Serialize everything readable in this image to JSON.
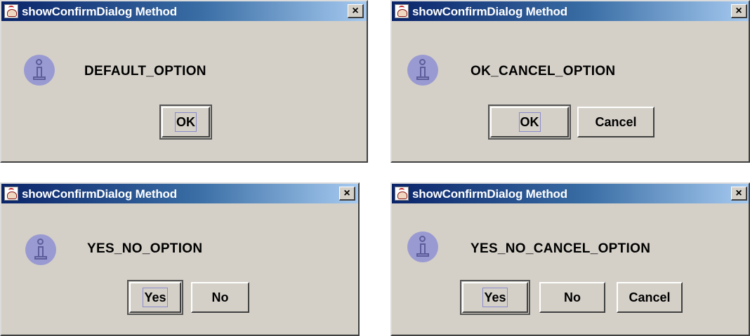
{
  "dialogs": [
    {
      "title": "showConfirmDialog Method",
      "close_label": "×",
      "icon": "information-icon",
      "message": "DEFAULT_OPTION",
      "buttons": [
        {
          "label": "OK",
          "default": true
        }
      ]
    },
    {
      "title": "showConfirmDialog Method",
      "close_label": "×",
      "icon": "information-icon",
      "message": "OK_CANCEL_OPTION",
      "buttons": [
        {
          "label": "OK",
          "default": true
        },
        {
          "label": "Cancel",
          "default": false
        }
      ]
    },
    {
      "title": "showConfirmDialog Method",
      "close_label": "×",
      "icon": "information-icon",
      "message": "YES_NO_OPTION",
      "buttons": [
        {
          "label": "Yes",
          "default": true
        },
        {
          "label": "No",
          "default": false
        }
      ]
    },
    {
      "title": "showConfirmDialog Method",
      "close_label": "×",
      "icon": "information-icon",
      "message": "YES_NO_CANCEL_OPTION",
      "buttons": [
        {
          "label": "Yes",
          "default": true
        },
        {
          "label": "No",
          "default": false
        },
        {
          "label": "Cancel",
          "default": false
        }
      ]
    }
  ],
  "colors": {
    "title_gradient_start": "#0a246a",
    "title_gradient_end": "#a6caf0",
    "dialog_background": "#d4d0c8",
    "info_icon": "#9a9ad2"
  }
}
